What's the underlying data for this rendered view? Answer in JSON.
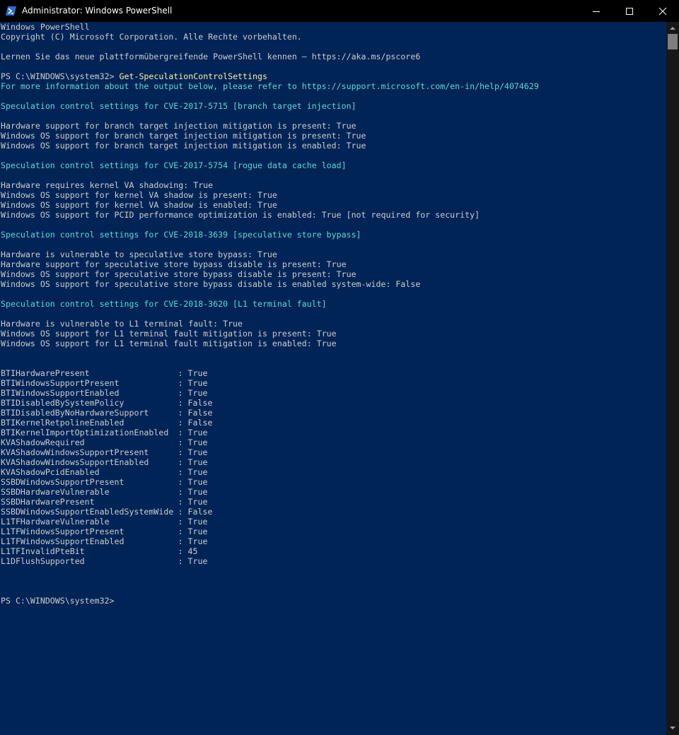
{
  "window": {
    "title": "Administrator: Windows PowerShell"
  },
  "icons": {
    "app": "powershell-icon",
    "minimize": "minimize-icon",
    "maximize": "maximize-icon",
    "close": "close-icon",
    "scroll_up": "chevron-up-icon",
    "scroll_down": "chevron-down-icon"
  },
  "colors": {
    "console_bg": "#012456",
    "text": "#cccccc",
    "command": "#f9f1a5",
    "info": "#61d6d6",
    "titlebar": "#000000"
  },
  "console": {
    "banner_1": "Windows PowerShell",
    "banner_2": "Copyright (C) Microsoft Corporation. Alle Rechte vorbehalten.",
    "banner_3": "Lernen Sie das neue plattformübergreifende PowerShell kennen – https://aka.ms/pscore6",
    "prompt_1": "PS C:\\WINDOWS\\system32> ",
    "command_1": "Get-SpeculationControlSettings",
    "info_line": "For more information about the output below, please refer to https://support.microsoft.com/en-in/help/4074629",
    "sections": [
      {
        "heading": "Speculation control settings for CVE-2017-5715 [branch target injection]",
        "lines": [
          "Hardware support for branch target injection mitigation is present: True",
          "Windows OS support for branch target injection mitigation is present: True",
          "Windows OS support for branch target injection mitigation is enabled: True"
        ]
      },
      {
        "heading": "Speculation control settings for CVE-2017-5754 [rogue data cache load]",
        "lines": [
          "Hardware requires kernel VA shadowing: True",
          "Windows OS support for kernel VA shadow is present: True",
          "Windows OS support for kernel VA shadow is enabled: True",
          "Windows OS support for PCID performance optimization is enabled: True [not required for security]"
        ]
      },
      {
        "heading": "Speculation control settings for CVE-2018-3639 [speculative store bypass]",
        "lines": [
          "Hardware is vulnerable to speculative store bypass: True",
          "Hardware support for speculative store bypass disable is present: True",
          "Windows OS support for speculative store bypass disable is present: True",
          "Windows OS support for speculative store bypass disable is enabled system-wide: False"
        ]
      },
      {
        "heading": "Speculation control settings for CVE-2018-3620 [L1 terminal fault]",
        "lines": [
          "Hardware is vulnerable to L1 terminal fault: True",
          "Windows OS support for L1 terminal fault mitigation is present: True",
          "Windows OS support for L1 terminal fault mitigation is enabled: True"
        ]
      }
    ],
    "properties": [
      {
        "name": "BTIHardwarePresent",
        "value": "True"
      },
      {
        "name": "BTIWindowsSupportPresent",
        "value": "True"
      },
      {
        "name": "BTIWindowsSupportEnabled",
        "value": "True"
      },
      {
        "name": "BTIDisabledBySystemPolicy",
        "value": "False"
      },
      {
        "name": "BTIDisabledByNoHardwareSupport",
        "value": "False"
      },
      {
        "name": "BTIKernelRetpolineEnabled",
        "value": "False"
      },
      {
        "name": "BTIKernelImportOptimizationEnabled",
        "value": "True"
      },
      {
        "name": "KVAShadowRequired",
        "value": "True"
      },
      {
        "name": "KVAShadowWindowsSupportPresent",
        "value": "True"
      },
      {
        "name": "KVAShadowWindowsSupportEnabled",
        "value": "True"
      },
      {
        "name": "KVAShadowPcidEnabled",
        "value": "True"
      },
      {
        "name": "SSBDWindowsSupportPresent",
        "value": "True"
      },
      {
        "name": "SSBDHardwareVulnerable",
        "value": "True"
      },
      {
        "name": "SSBDHardwarePresent",
        "value": "True"
      },
      {
        "name": "SSBDWindowsSupportEnabledSystemWide",
        "value": "False"
      },
      {
        "name": "L1TFHardwareVulnerable",
        "value": "True"
      },
      {
        "name": "L1TFWindowsSupportPresent",
        "value": "True"
      },
      {
        "name": "L1TFWindowsSupportEnabled",
        "value": "True"
      },
      {
        "name": "L1TFInvalidPteBit",
        "value": "45"
      },
      {
        "name": "L1DFlushSupported",
        "value": "True"
      }
    ],
    "property_separator": " : ",
    "prompt_2": "PS C:\\WINDOWS\\system32>"
  }
}
